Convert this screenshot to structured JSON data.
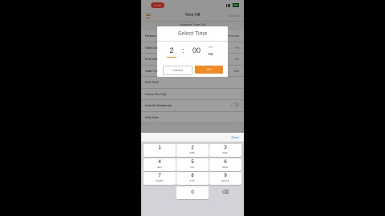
{
  "status": {
    "time": "10:00"
  },
  "nav": {
    "title": "Time Off",
    "action": "Submit"
  },
  "form": {
    "subheader": "Request Time Off",
    "rows": [
      {
        "label": "Reason",
        "value": "Personal"
      },
      {
        "label": "Start Date",
        "value": "Fri"
      },
      {
        "label": "End Date",
        "value": "Fri"
      },
      {
        "label": "Start Time",
        "value": "AM"
      },
      {
        "label": "End Time",
        "value": ""
      },
      {
        "label": "Hours Per Day",
        "value": ""
      },
      {
        "label": "Include Weekends",
        "value": ""
      },
      {
        "label": "Add Note",
        "value": ""
      }
    ]
  },
  "dialog": {
    "title": "Select Time",
    "hour": "2",
    "separator": ":",
    "minute": "00",
    "am": "AM",
    "pm": "PM",
    "cancel": "Cancel",
    "ok": "OK"
  },
  "keyboard": {
    "done": "Done",
    "keys": [
      {
        "n": "1",
        "l": ""
      },
      {
        "n": "2",
        "l": "ABC"
      },
      {
        "n": "3",
        "l": "DEF"
      },
      {
        "n": "4",
        "l": "GHI"
      },
      {
        "n": "5",
        "l": "JKL"
      },
      {
        "n": "6",
        "l": "MNO"
      },
      {
        "n": "7",
        "l": "PQRS"
      },
      {
        "n": "8",
        "l": "TUV"
      },
      {
        "n": "9",
        "l": "WXYZ"
      },
      {
        "n": "0",
        "l": ""
      }
    ],
    "delete_glyph": "⌫"
  },
  "colors": {
    "accent": "#f08a24",
    "recording": "#ff3b30"
  }
}
